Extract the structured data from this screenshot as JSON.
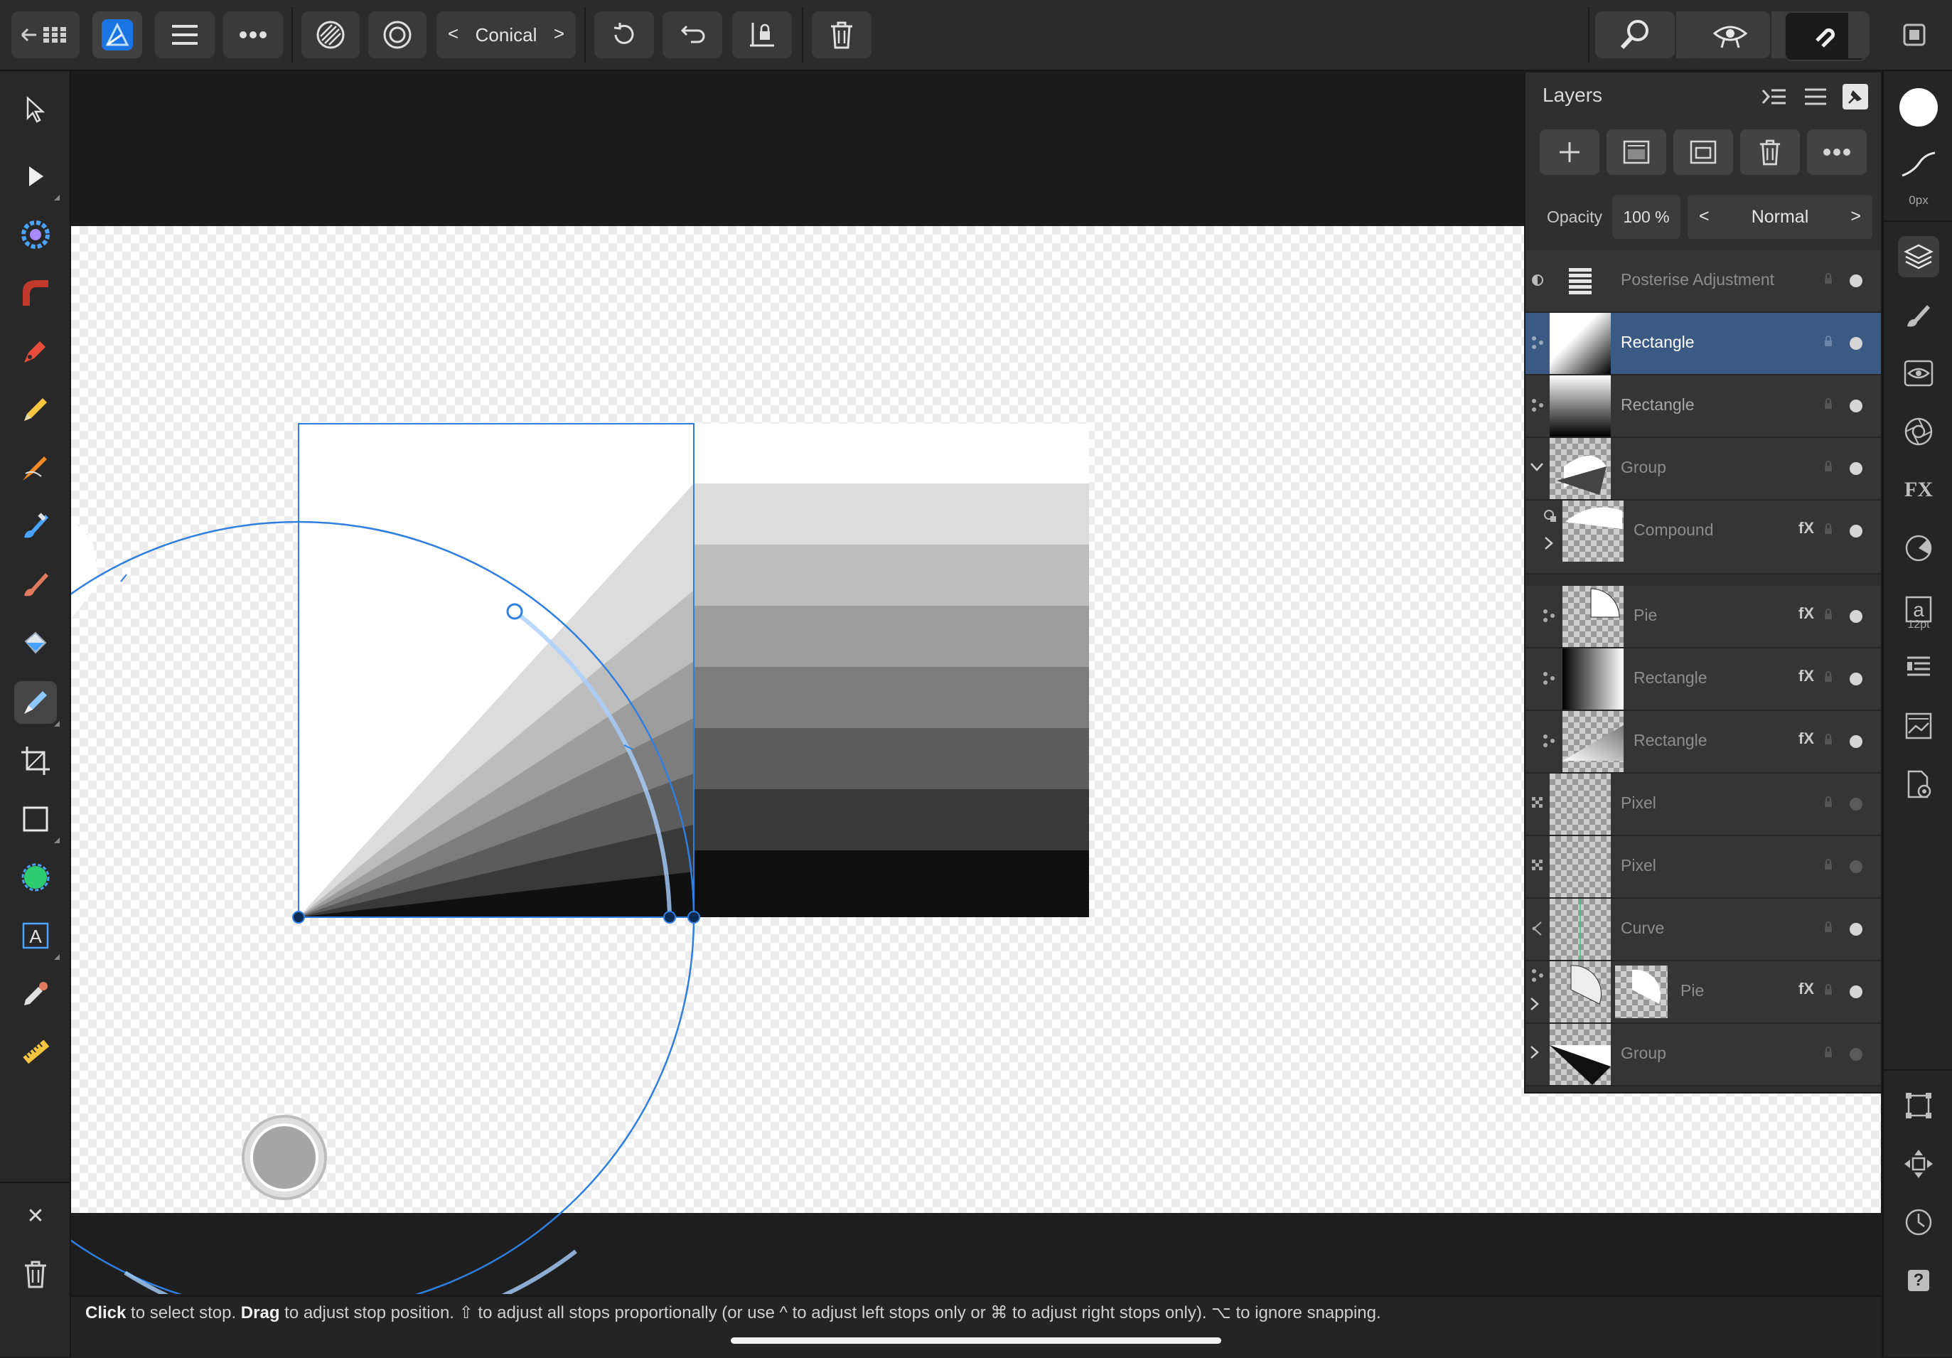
{
  "topbar": {
    "gradient_type": "Conical",
    "prev_symbol": "<",
    "next_symbol": ">"
  },
  "layers_panel": {
    "title": "Layers",
    "opacity_label": "Opacity",
    "opacity_value": "100 %",
    "blend_mode": "Normal",
    "blend_prev": "<",
    "blend_next": ">",
    "layers": [
      {
        "name": "Posterise Adjustment",
        "selected": false,
        "fx": false
      },
      {
        "name": "Rectangle",
        "selected": true,
        "fx": false
      },
      {
        "name": "Rectangle",
        "selected": false,
        "fx": false
      },
      {
        "name": "Group",
        "selected": false,
        "fx": false
      },
      {
        "name": "Compound",
        "selected": false,
        "fx": true
      },
      {
        "name": "Pie",
        "selected": false,
        "fx": true
      },
      {
        "name": "Rectangle",
        "selected": false,
        "fx": true
      },
      {
        "name": "Rectangle",
        "selected": false,
        "fx": true
      },
      {
        "name": "Pixel",
        "selected": false,
        "fx": false
      },
      {
        "name": "Pixel",
        "selected": false,
        "fx": false
      },
      {
        "name": "Curve",
        "selected": false,
        "fx": false
      },
      {
        "name": "Pie",
        "selected": false,
        "fx": true
      },
      {
        "name": "Group",
        "selected": false,
        "fx": false
      }
    ],
    "fx_label": "fX"
  },
  "right_strip": {
    "stroke_width": "0px",
    "font_size": "12pt",
    "text_glyph": "a",
    "fx_label": "FX",
    "help_glyph": "?"
  },
  "status": {
    "click": "Click",
    "t1": " to select stop. ",
    "drag": "Drag",
    "t2": " to adjust stop position. ⇧ to adjust all stops proportionally (or use ^ to adjust left stops only or ⌘ to adjust right stops only). ⌥ to ignore snapping."
  },
  "left_toolbar": {
    "text_tool_glyph": "A",
    "close_glyph": "✕"
  }
}
